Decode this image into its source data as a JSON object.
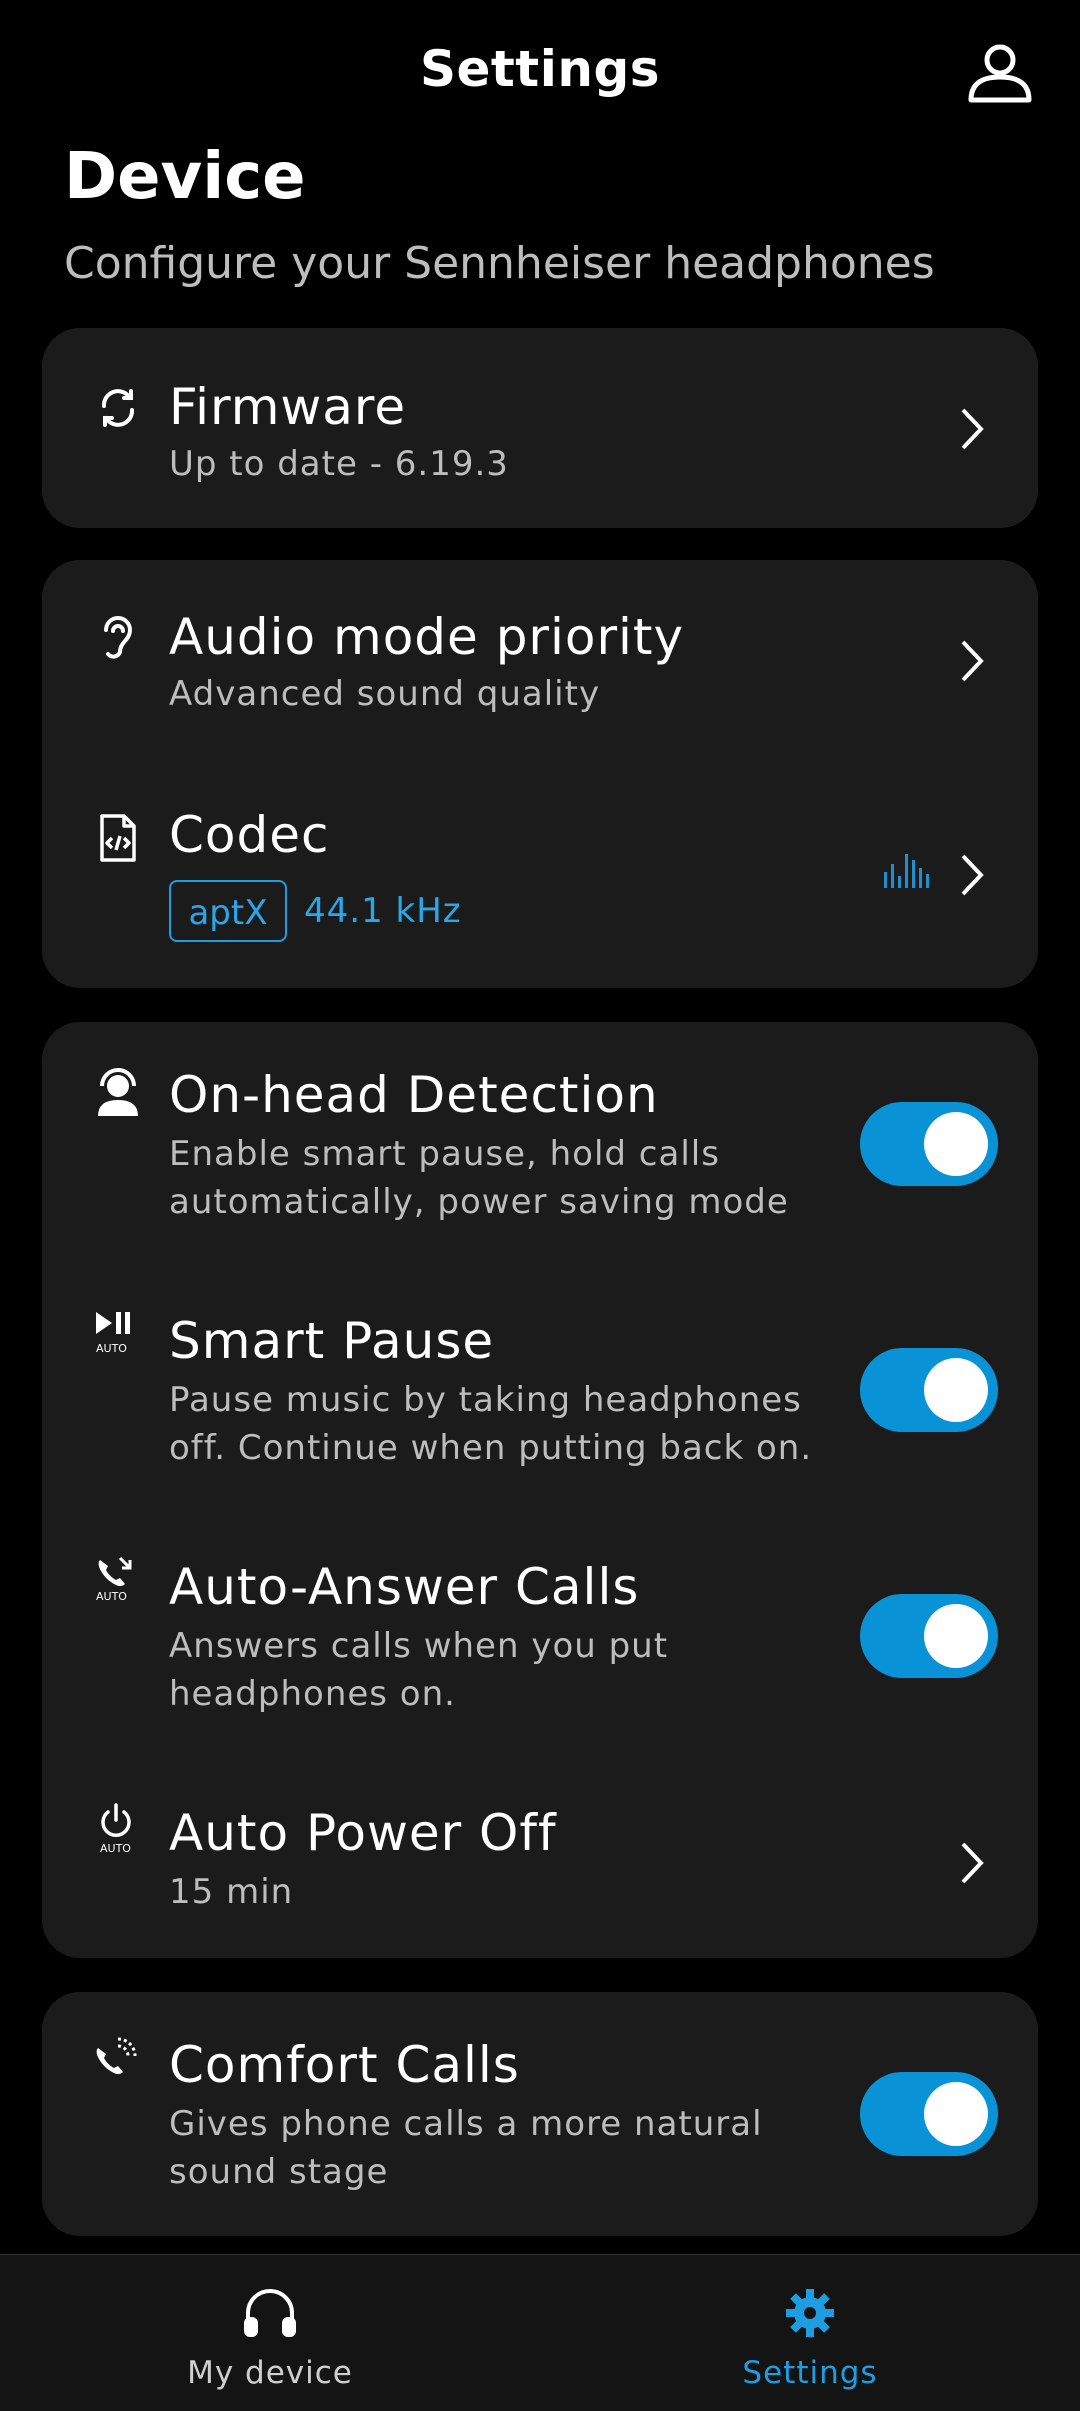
{
  "header": {
    "title": "Settings",
    "profile_icon": "person-icon"
  },
  "section": {
    "title": "Device",
    "subtitle": "Configure your Sennheiser headphones"
  },
  "firmware": {
    "icon": "sync-icon",
    "label": "Firmware",
    "detail": "Up to date - 6.19.3"
  },
  "audio_mode": {
    "icon": "ear-icon",
    "label": "Audio mode priority",
    "detail": "Advanced sound quality"
  },
  "codec": {
    "icon": "code-file-icon",
    "label": "Codec",
    "badge": "aptX",
    "frequency": "44.1 kHz",
    "indicator_icon": "audio-bars-icon"
  },
  "on_head": {
    "icon": "head-detection-icon",
    "label": "On-head Detection",
    "detail_line1": "Enable smart pause, hold calls",
    "detail_line2": "automatically, power saving mode",
    "enabled": true
  },
  "smart_pause": {
    "icon": "play-pause-auto-icon",
    "label": "Smart Pause",
    "detail_line1": "Pause music by taking headphones",
    "detail_line2": "off. Continue when putting back on.",
    "enabled": true
  },
  "auto_answer": {
    "icon": "phone-auto-icon",
    "label": "Auto-Answer Calls",
    "detail_line1": "Answers calls when you put",
    "detail_line2": "headphones on.",
    "enabled": true
  },
  "auto_power": {
    "icon": "power-auto-icon",
    "label": "Auto Power Off",
    "detail": "15 min"
  },
  "comfort_calls": {
    "icon": "phone-sound-icon",
    "label": "Comfort Calls",
    "detail_line1": "Gives phone calls a more natural",
    "detail_line2": "sound stage",
    "enabled": true
  },
  "nav": [
    {
      "label": "My device",
      "icon": "headphones-icon",
      "active": false
    },
    {
      "label": "Settings",
      "icon": "gear-icon",
      "active": true
    }
  ],
  "colors": {
    "accent": "#0993D6",
    "background": "#000000",
    "card": "#1B1B1B",
    "secondary_text": "#BDBDBD"
  }
}
